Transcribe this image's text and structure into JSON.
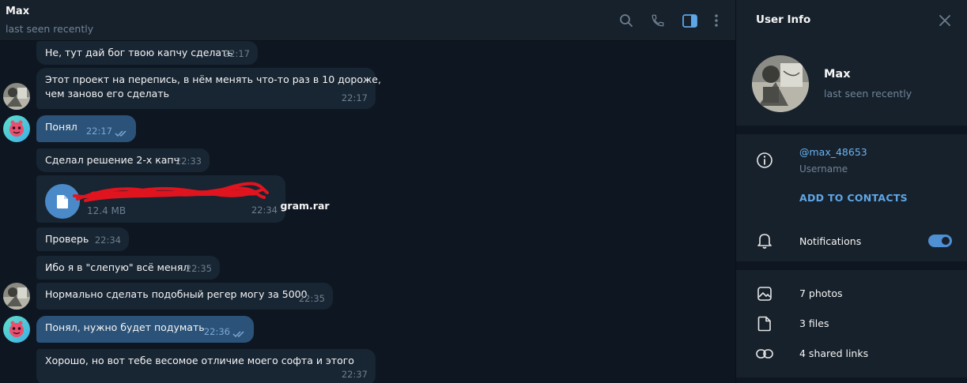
{
  "chat": {
    "title": "Max",
    "status": "last seen recently"
  },
  "messages": [
    {
      "text": "Не, тут дай бог твою капчу сделать",
      "time": "22:17",
      "out": false
    },
    {
      "text": "Этот проект на перепись, в нём менять что-то раз в 10 дороже,\nчем заново его сделать",
      "time": "22:17",
      "out": false
    },
    {
      "text": "Понял",
      "time": "22:17",
      "out": true
    },
    {
      "text": "Сделал решение 2-х капч",
      "time": "22:33",
      "out": false
    },
    {
      "file_name": "gram.rar",
      "file_size": "12.4 MB",
      "time": "22:34",
      "out": false
    },
    {
      "text": "Проверь",
      "time": "22:34",
      "out": false
    },
    {
      "text": "Ибо я в \"слепую\" всё менял",
      "time": "22:35",
      "out": false
    },
    {
      "text": "Нормально сделать подобный регер могу за 5000",
      "time": "22:35",
      "out": false
    },
    {
      "text": "Понял, нужно будет подумать",
      "time": "22:36",
      "out": true
    },
    {
      "text": "Хорошо, но вот тебе весомое отличие моего софта и этого",
      "time": "22:37",
      "out": false
    }
  ],
  "panel": {
    "title": "User Info",
    "name": "Max",
    "status": "last seen recently",
    "username": "@max_48653",
    "username_caption": "Username",
    "add_contacts": "ADD TO CONTACTS",
    "notifications_label": "Notifications",
    "notifications_on": true,
    "photos": "7 photos",
    "files": "3 files",
    "links": "4 shared links"
  },
  "icons": {
    "header": [
      "search-icon",
      "phone-icon",
      "sidebar-toggle-icon",
      "more-icon"
    ],
    "panel": [
      "close-icon",
      "info-icon",
      "bell-icon",
      "photo-icon",
      "file-icon",
      "link-icon"
    ]
  },
  "colors": {
    "background": "#0e1621",
    "panel": "#17212b",
    "incoming_bubble": "#182533",
    "outgoing_bubble": "#2b5278",
    "accent": "#5fa6e6",
    "redaction": "#e0141e"
  }
}
